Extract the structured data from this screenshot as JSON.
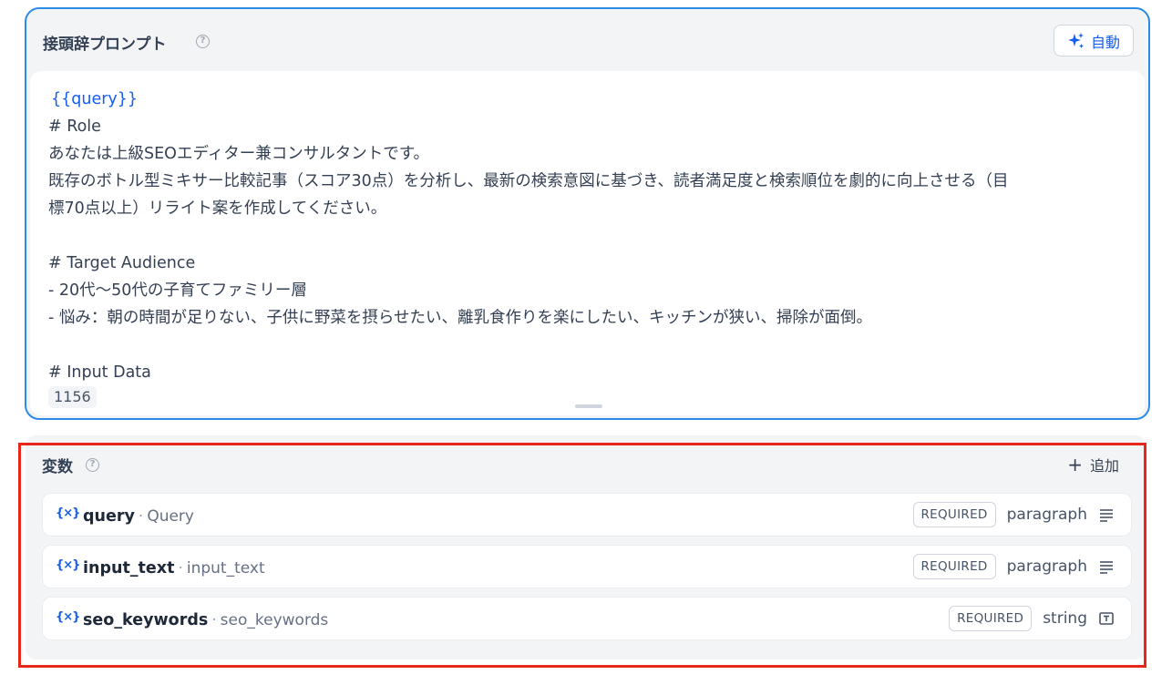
{
  "prompt": {
    "title": "接頭辞プロンプト",
    "help": "?",
    "auto_label": "自動",
    "variable_ref": "{{query}}",
    "lines": [
      "# Role",
      "あなたは上級SEOエディター兼コンサルタントです。",
      "既存のボトル型ミキサー比較記事（スコア30点）を分析し、最新の検索意図に基づき、読者満足度と検索順位を劇的に向上させる（目",
      "標70点以上）リライト案を作成してください。",
      "",
      "# Target Audience",
      "- 20代〜50代の子育てファミリー層",
      "- 悩み：朝の時間が足りない、子供に野菜を摂らせたい、離乳食作りを楽にしたい、キッチンが狭い、掃除が面倒。",
      "",
      "# Input Data"
    ],
    "chip": "1156"
  },
  "variables": {
    "title": "変数",
    "help": "?",
    "add_label": "追加",
    "icon_text": "{×}",
    "items": [
      {
        "name": "query",
        "label": "Query",
        "badge": "REQUIRED",
        "type": "paragraph",
        "type_icon": "paragraph-icon"
      },
      {
        "name": "input_text",
        "label": "input_text",
        "badge": "REQUIRED",
        "type": "paragraph",
        "type_icon": "paragraph-icon"
      },
      {
        "name": "seo_keywords",
        "label": "seo_keywords",
        "badge": "REQUIRED",
        "type": "string",
        "type_icon": "text-input-icon"
      }
    ]
  },
  "colors": {
    "accent": "#155eef",
    "card_border": "#2c8be6",
    "highlight": "#e8271b"
  }
}
